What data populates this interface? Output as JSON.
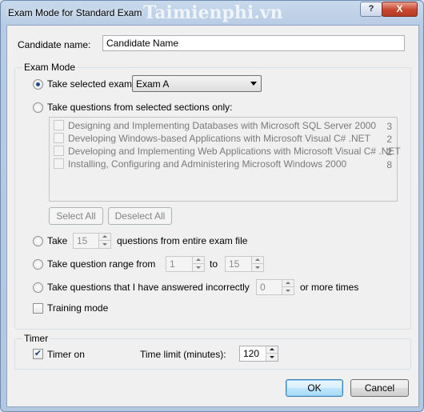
{
  "window": {
    "title": "Exam Mode for Standard Exam",
    "watermark": "Taimienphi.vn",
    "help_glyph": "?",
    "close_glyph": "X"
  },
  "candidate": {
    "label": "Candidate name:",
    "value": "Candidate Name"
  },
  "exam_mode": {
    "group_title": "Exam Mode",
    "take_selected": {
      "label": "Take selected exam:",
      "checked": true,
      "selected_exam": "Exam A"
    },
    "take_sections": {
      "label": "Take questions from selected sections only:",
      "checked": false,
      "sections": [
        {
          "name": "Designing and Implementing Databases with Microsoft SQL Server 2000",
          "count": "3"
        },
        {
          "name": "Developing Windows-based Applications with Microsoft Visual C# .NET",
          "count": "2"
        },
        {
          "name": "Developing and Implementing Web Applications with Microsoft Visual C# .NET",
          "count": "2"
        },
        {
          "name": "Installing, Configuring and Administering Microsoft Windows 2000",
          "count": "8"
        }
      ],
      "select_all_label": "Select All",
      "deselect_all_label": "Deselect All"
    },
    "take_n": {
      "label_pre": "Take",
      "value": "15",
      "label_post": "questions from entire exam file"
    },
    "take_range": {
      "label_pre": "Take question range from",
      "from": "1",
      "label_mid": "to",
      "to": "15"
    },
    "take_incorrect": {
      "label_pre": "Take questions that I have answered incorrectly",
      "value": "0",
      "label_post": "or more times"
    },
    "training_mode": {
      "label": "Training mode",
      "checked": false
    }
  },
  "timer": {
    "group_title": "Timer",
    "timer_on_label": "Timer on",
    "timer_on_checked": true,
    "time_limit_label": "Time limit (minutes):",
    "time_limit_value": "120"
  },
  "footer": {
    "ok_label": "OK",
    "cancel_label": "Cancel"
  },
  "colors": {
    "frame": "#b7cce4",
    "close_button": "#c8452f",
    "default_button_border": "#3c7fb1"
  }
}
